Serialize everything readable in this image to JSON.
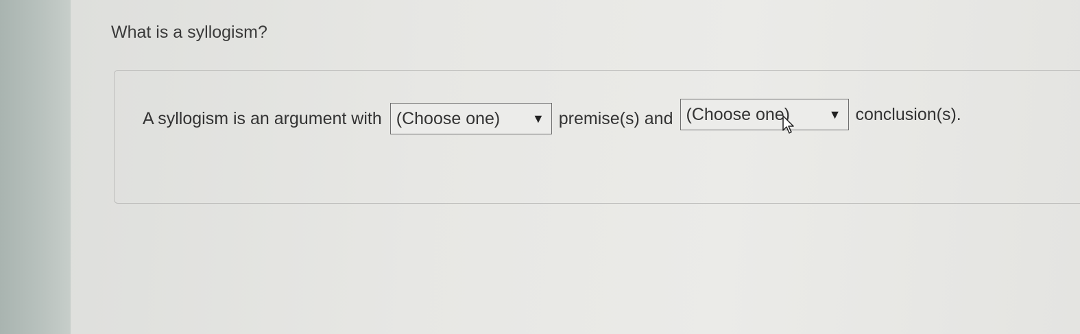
{
  "question": {
    "title": "What is a syllogism?"
  },
  "sentence": {
    "part1": "A syllogism is an argument with",
    "part2": "premise(s) and",
    "part3": "conclusion(s)."
  },
  "dropdowns": [
    {
      "selected": "(Choose one)",
      "icon": "triangle-down-icon"
    },
    {
      "selected": "(Choose one)",
      "icon": "triangle-down-icon"
    }
  ],
  "caret_glyph": "▼"
}
